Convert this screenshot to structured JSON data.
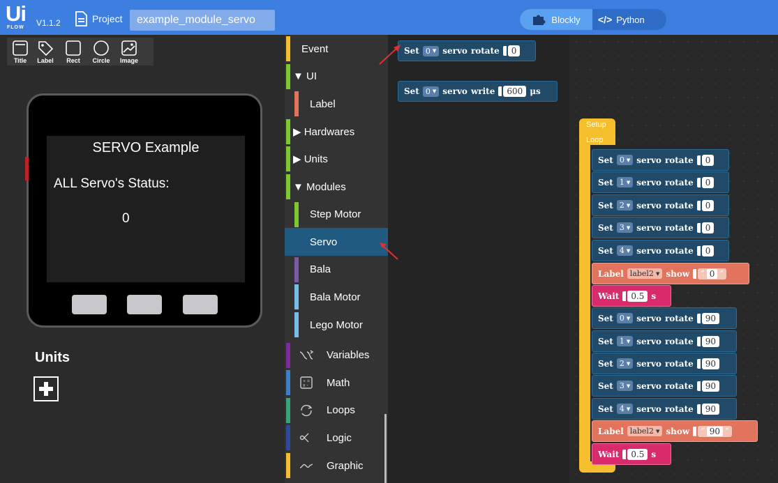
{
  "topbar": {
    "logo_text": "Ui",
    "logo_sub": "FLOW",
    "version": "V1.1.2",
    "project_label": "Project",
    "project_name": "example_module_servo",
    "mode_blockly": "Blockly",
    "mode_python": "Python"
  },
  "widgets": [
    {
      "label": "Title",
      "icon": "title-icon"
    },
    {
      "label": "Label",
      "icon": "label-icon"
    },
    {
      "label": "Rect",
      "icon": "rect-icon"
    },
    {
      "label": "Circle",
      "icon": "circle-icon"
    },
    {
      "label": "Image",
      "icon": "image-icon"
    }
  ],
  "screen": {
    "title": "SERVO Example",
    "status": "ALL Servo's Status:",
    "value": "0"
  },
  "units": {
    "title": "Units"
  },
  "categories": [
    {
      "label": "Event",
      "color": "#f4be2c"
    },
    {
      "label": "UI",
      "color": "#7ec832",
      "expander": "▼"
    },
    {
      "label": "Label",
      "color": "#e2735c"
    },
    {
      "label": "Hardwares",
      "color": "#7ec832",
      "expander": "▶"
    },
    {
      "label": "Units",
      "color": "#7ec832",
      "expander": "▶"
    },
    {
      "label": "Modules",
      "color": "#7ec832",
      "expander": "▼"
    },
    {
      "label": "Step Motor",
      "color": "#7ec832"
    },
    {
      "label": "Servo",
      "color": "#205a80"
    },
    {
      "label": "Bala",
      "color": "#7b5aa6"
    },
    {
      "label": "Bala Motor",
      "color": "#7bbbe8"
    },
    {
      "label": "Lego Motor",
      "color": "#7bbbe8"
    },
    {
      "label": "Variables",
      "color": "#7b2d9a",
      "icon": "variables-icon"
    },
    {
      "label": "Math",
      "color": "#3d7fc6",
      "icon": "math-icon"
    },
    {
      "label": "Loops",
      "color": "#3aa37a",
      "icon": "loops-icon"
    },
    {
      "label": "Logic",
      "color": "#2f4a9a",
      "icon": "logic-icon"
    },
    {
      "label": "Graphic",
      "color": "#f4be2c",
      "icon": "graphic-icon"
    }
  ],
  "flyout": {
    "rotate_block": {
      "set": "Set",
      "port": "0",
      "servo": "servo",
      "action": "rotate",
      "value": "0"
    },
    "write_block": {
      "set": "Set",
      "port": "0",
      "servo": "servo",
      "action": "write",
      "value": "600",
      "unit": "μs"
    }
  },
  "program": {
    "setup_label": "Setup",
    "loop_label": "Loop",
    "blocks": [
      {
        "kind": "servo",
        "set": "Set",
        "port": "0",
        "servo": "servo",
        "action": "rotate",
        "value": "0"
      },
      {
        "kind": "servo",
        "set": "Set",
        "port": "1",
        "servo": "servo",
        "action": "rotate",
        "value": "0"
      },
      {
        "kind": "servo",
        "set": "Set",
        "port": "2",
        "servo": "servo",
        "action": "rotate",
        "value": "0"
      },
      {
        "kind": "servo",
        "set": "Set",
        "port": "3",
        "servo": "servo",
        "action": "rotate",
        "value": "0"
      },
      {
        "kind": "servo",
        "set": "Set",
        "port": "4",
        "servo": "servo",
        "action": "rotate",
        "value": "0"
      },
      {
        "kind": "label",
        "word": "Label",
        "target": "label2",
        "show": "show",
        "value": "0"
      },
      {
        "kind": "wait",
        "word": "Wait",
        "value": "0.5",
        "unit": "s"
      },
      {
        "kind": "servo",
        "set": "Set",
        "port": "0",
        "servo": "servo",
        "action": "rotate",
        "value": "90"
      },
      {
        "kind": "servo",
        "set": "Set",
        "port": "1",
        "servo": "servo",
        "action": "rotate",
        "value": "90"
      },
      {
        "kind": "servo",
        "set": "Set",
        "port": "2",
        "servo": "servo",
        "action": "rotate",
        "value": "90"
      },
      {
        "kind": "servo",
        "set": "Set",
        "port": "3",
        "servo": "servo",
        "action": "rotate",
        "value": "90"
      },
      {
        "kind": "servo",
        "set": "Set",
        "port": "4",
        "servo": "servo",
        "action": "rotate",
        "value": "90"
      },
      {
        "kind": "label",
        "word": "Label",
        "target": "label2",
        "show": "show",
        "value": "90"
      },
      {
        "kind": "wait",
        "word": "Wait",
        "value": "0.5",
        "unit": "s"
      }
    ]
  },
  "colors": {
    "topbar": "#3d7fe0",
    "servo_block": "#204a68",
    "label_block": "#e2735c",
    "wait_block": "#d92a6b",
    "setup_block": "#f4be2c",
    "arrow": "#e03030"
  }
}
